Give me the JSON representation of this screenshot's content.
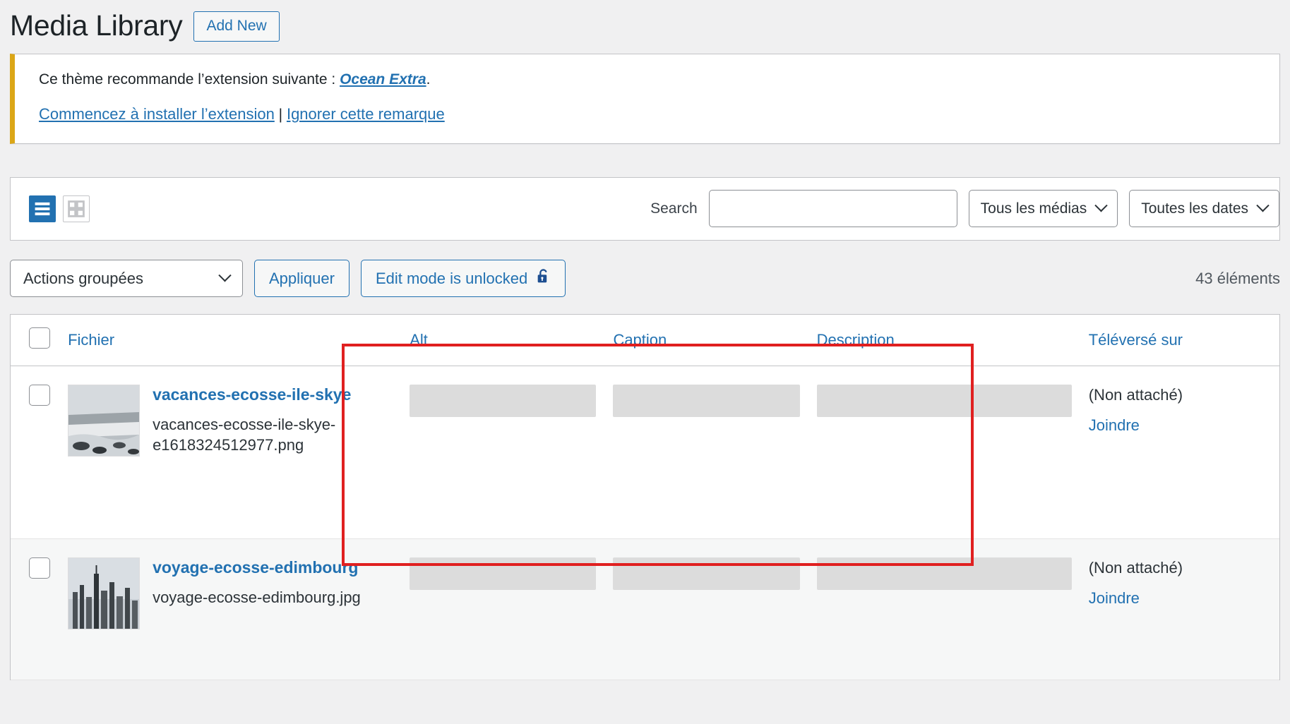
{
  "header": {
    "title": "Media Library",
    "add_new_label": "Add New"
  },
  "notice": {
    "line1_prefix": "Ce thème recommande l’extension suivante : ",
    "plugin_name": "Ocean Extra",
    "line1_suffix": ".",
    "install_link": "Commencez à installer l’extension",
    "separator": "|",
    "dismiss_link": "Ignorer cette remarque"
  },
  "viewbar": {
    "list_view_icon": "list-view-icon",
    "grid_view_icon": "grid-view-icon",
    "search_label": "Search",
    "search_value": "",
    "search_placeholder": "",
    "media_filter": "Tous les médias",
    "date_filter": "Toutes les dates"
  },
  "bulk": {
    "bulk_actions_label": "Actions groupées",
    "apply_label": "Appliquer",
    "edit_mode_label": "Edit mode is unlocked",
    "lock_icon": "unlocked-padlock-icon",
    "item_count": "43 éléments"
  },
  "table": {
    "columns": [
      {
        "key": "checkbox",
        "label": ""
      },
      {
        "key": "file",
        "label": "Fichier"
      },
      {
        "key": "alt",
        "label": "Alt"
      },
      {
        "key": "caption",
        "label": "Caption"
      },
      {
        "key": "description",
        "label": "Description"
      },
      {
        "key": "uploaded_to",
        "label": "Téléversé sur"
      }
    ],
    "rows": [
      {
        "title": "vacances-ecosse-ile-skye",
        "filename": "vacances-ecosse-ile-skye-e1618324512977.png",
        "alt": "",
        "caption": "",
        "description": "",
        "uploaded_to": "(Non attaché)",
        "attach_link": "Joindre"
      },
      {
        "title": "voyage-ecosse-edimbourg",
        "filename": "voyage-ecosse-edimbourg.jpg",
        "alt": "",
        "caption": "",
        "description": "",
        "uploaded_to": "(Non attaché)",
        "attach_link": "Joindre"
      }
    ]
  },
  "annotation": {
    "color": "#e02020"
  }
}
